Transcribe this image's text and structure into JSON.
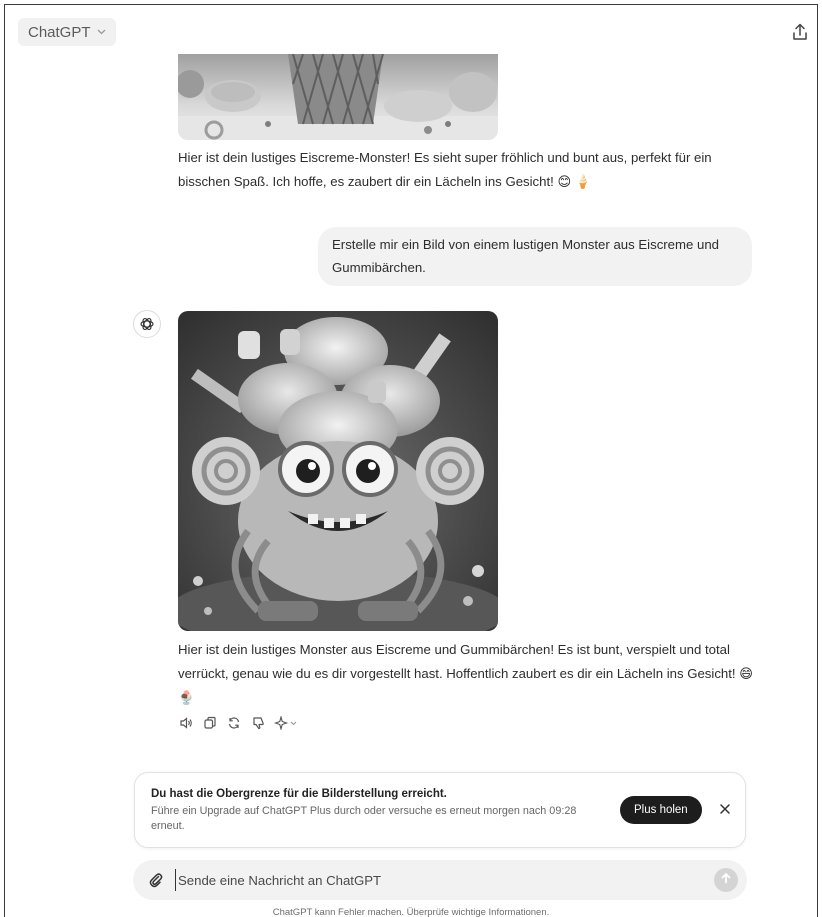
{
  "header": {
    "model_label": "ChatGPT",
    "model_icon": "chevron-down-icon",
    "share_icon": "share-icon"
  },
  "conversation": {
    "assistant_reply_1": "Hier ist dein lustiges Eiscreme-Monster! Es sieht super fröhlich und bunt aus, perfekt für ein bisschen Spaß. Ich hoffe, es zaubert dir ein Lächeln ins Gesicht! 😊 🍦",
    "user_message": "Erstelle mir ein Bild von einem lustigen Monster aus Eiscreme und Gummibärchen.",
    "assistant_reply_2": "Hier ist dein lustiges Monster aus Eiscreme und Gummibärchen! Es ist bunt, verspielt und total verrückt, genau wie du es dir vorgestellt hast. Hoffentlich zaubert es dir ein Lächeln ins Gesicht! 😄🍨",
    "message_actions": [
      "speaker-icon",
      "copy-icon",
      "regenerate-icon",
      "thumbs-down-icon",
      "sparkle-icon"
    ]
  },
  "limit_notice": {
    "title": "Du hast die Obergrenze für die Bilderstellung erreicht.",
    "body": "Führe ein Upgrade auf ChatGPT Plus durch oder versuche es erneut morgen nach 09:28 erneut.",
    "button_label": "Plus holen",
    "close_icon": "close-icon"
  },
  "composer": {
    "placeholder": "Sende eine Nachricht an ChatGPT",
    "attach_icon": "paperclip-icon",
    "send_icon": "arrow-up-icon"
  },
  "footer": {
    "disclaimer": "ChatGPT kann Fehler machen. Überprüfe wichtige Informationen."
  },
  "colors": {
    "bubble_bg": "#f2f2f2",
    "button_dark": "#1d1d1d",
    "send_disabled": "#d4d4d4"
  }
}
